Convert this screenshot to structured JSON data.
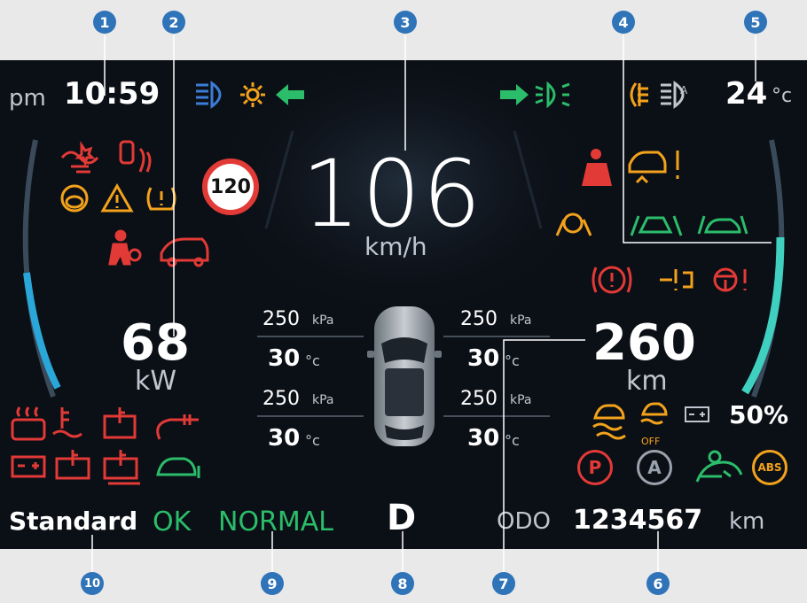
{
  "top_bar": {
    "ampm": "pm",
    "time": "10:59",
    "temperature": "24",
    "temperature_unit": "°c"
  },
  "speed": {
    "value": "106",
    "unit": "km/h"
  },
  "speed_limit_sign": "120",
  "power": {
    "value": "68",
    "unit": "kW"
  },
  "range": {
    "value": "260",
    "unit": "km"
  },
  "battery_percent": "50%",
  "tires": {
    "front_left": {
      "pressure": "250",
      "pressure_unit": "kPa",
      "temp": "30",
      "temp_unit": "°c"
    },
    "front_right": {
      "pressure": "250",
      "pressure_unit": "kPa",
      "temp": "30",
      "temp_unit": "°c"
    },
    "rear_left": {
      "pressure": "250",
      "pressure_unit": "kPa",
      "temp": "30",
      "temp_unit": "°c"
    },
    "rear_right": {
      "pressure": "250",
      "pressure_unit": "kPa",
      "temp": "30",
      "temp_unit": "°c"
    }
  },
  "bottom_bar": {
    "mode": "Standard",
    "ok": "OK",
    "normal": "NORMAL",
    "gear": "D",
    "odo_label": "ODO",
    "odo_value": "1234567",
    "odo_unit": "km"
  },
  "callouts": [
    "1",
    "2",
    "3",
    "4",
    "5",
    "6",
    "7",
    "8",
    "9",
    "10"
  ],
  "icons": {
    "small_off": "OFF",
    "p": "P",
    "a": "A",
    "abs": "ABS"
  },
  "colors": {
    "red": "#e23a36",
    "orange": "#f3a21c",
    "green": "#2bbd6a",
    "blue": "#2f73b8",
    "cyan": "#3fd0c0"
  }
}
